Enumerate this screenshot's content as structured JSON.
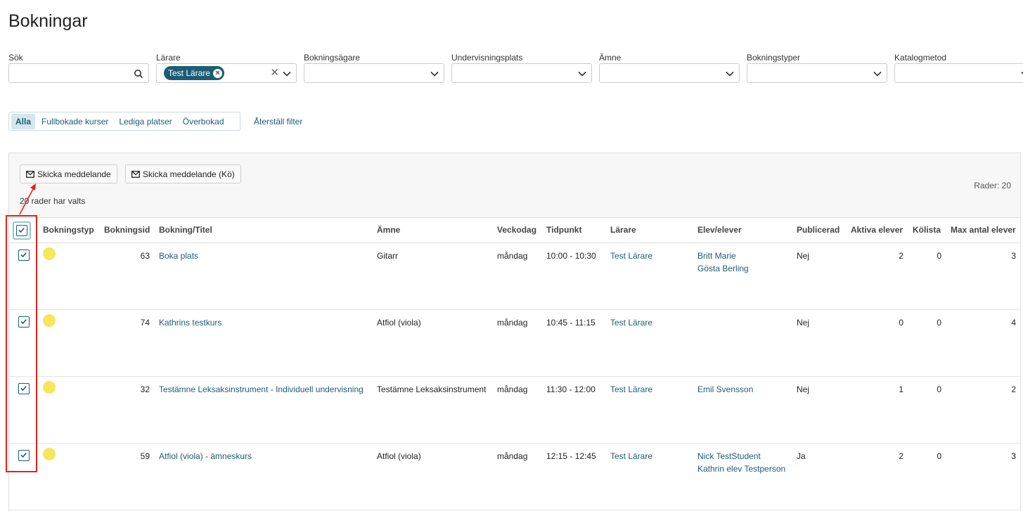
{
  "title": "Bokningar",
  "filters": [
    {
      "label": "Sök",
      "type": "search"
    },
    {
      "label": "Lärare",
      "type": "select",
      "chip": "Test Lärare",
      "clearable": true
    },
    {
      "label": "Bokningsägare",
      "type": "select"
    },
    {
      "label": "Undervisningsplats",
      "type": "select"
    },
    {
      "label": "Ämne",
      "type": "select"
    },
    {
      "label": "Bokningstyper",
      "type": "select"
    },
    {
      "label": "Katalogmetod",
      "type": "select"
    }
  ],
  "tabs": [
    "Alla",
    "Fullbokade kurser",
    "Lediga platser",
    "Överbokad"
  ],
  "active_tab": "Alla",
  "reset_filter": "Återställ filter",
  "toolbar": {
    "send_message": "Skicka meddelande",
    "send_message_queue": "Skicka meddelande (Kö)",
    "selected_text": "20 rader har valts",
    "row_count": "Rader: 20"
  },
  "columns": [
    "Bokningstyp",
    "Bokningsid",
    "Bokning/Titel",
    "Ämne",
    "Veckodag",
    "Tidpunkt",
    "Lärare",
    "Elev/elever",
    "Publicerad",
    "Aktiva elever",
    "Kölista",
    "Max antal elever"
  ],
  "rows": [
    {
      "id": "63",
      "title": "Boka plats",
      "subject": "Gitarr",
      "weekday": "måndag",
      "time": "10:00 - 10:30",
      "teacher": "Test Lärare",
      "students": [
        "Britt Marie",
        "Gösta Berling"
      ],
      "published": "Nej",
      "active": "2",
      "queue": "0",
      "max": "3"
    },
    {
      "id": "74",
      "title": "Kathrins testkurs",
      "subject": "Atfiol (viola)",
      "weekday": "måndag",
      "time": "10:45 - 11:15",
      "teacher": "Test Lärare",
      "students": [],
      "published": "Nej",
      "active": "0",
      "queue": "0",
      "max": "4"
    },
    {
      "id": "32",
      "title": "Testämne Leksaksinstrument - Individuell undervisning",
      "subject": "Testämne Leksaksinstrument",
      "weekday": "måndag",
      "time": "11:30 - 12:00",
      "teacher": "Test Lärare",
      "students": [
        "Emil Svensson"
      ],
      "published": "Nej",
      "active": "1",
      "queue": "0",
      "max": "2"
    },
    {
      "id": "59",
      "title": "Atfiol (viola) - ämneskurs",
      "subject": "Atfiol (viola)",
      "weekday": "måndag",
      "time": "12:15 - 12:45",
      "teacher": "Test Lärare",
      "students": [
        "Nick TestStudent",
        "Kathrin elev Testperson"
      ],
      "published": "Ja",
      "active": "2",
      "queue": "0",
      "max": "3"
    }
  ],
  "colors": {
    "accent": "#1c5d73",
    "booking_type_dot": "#f7e55c",
    "annotation": "#e0231c"
  },
  "icons": {
    "search": "search-icon",
    "caret": "chevron-down-icon",
    "mail": "envelope-icon",
    "checkbox": "checkbox-checked-icon"
  }
}
